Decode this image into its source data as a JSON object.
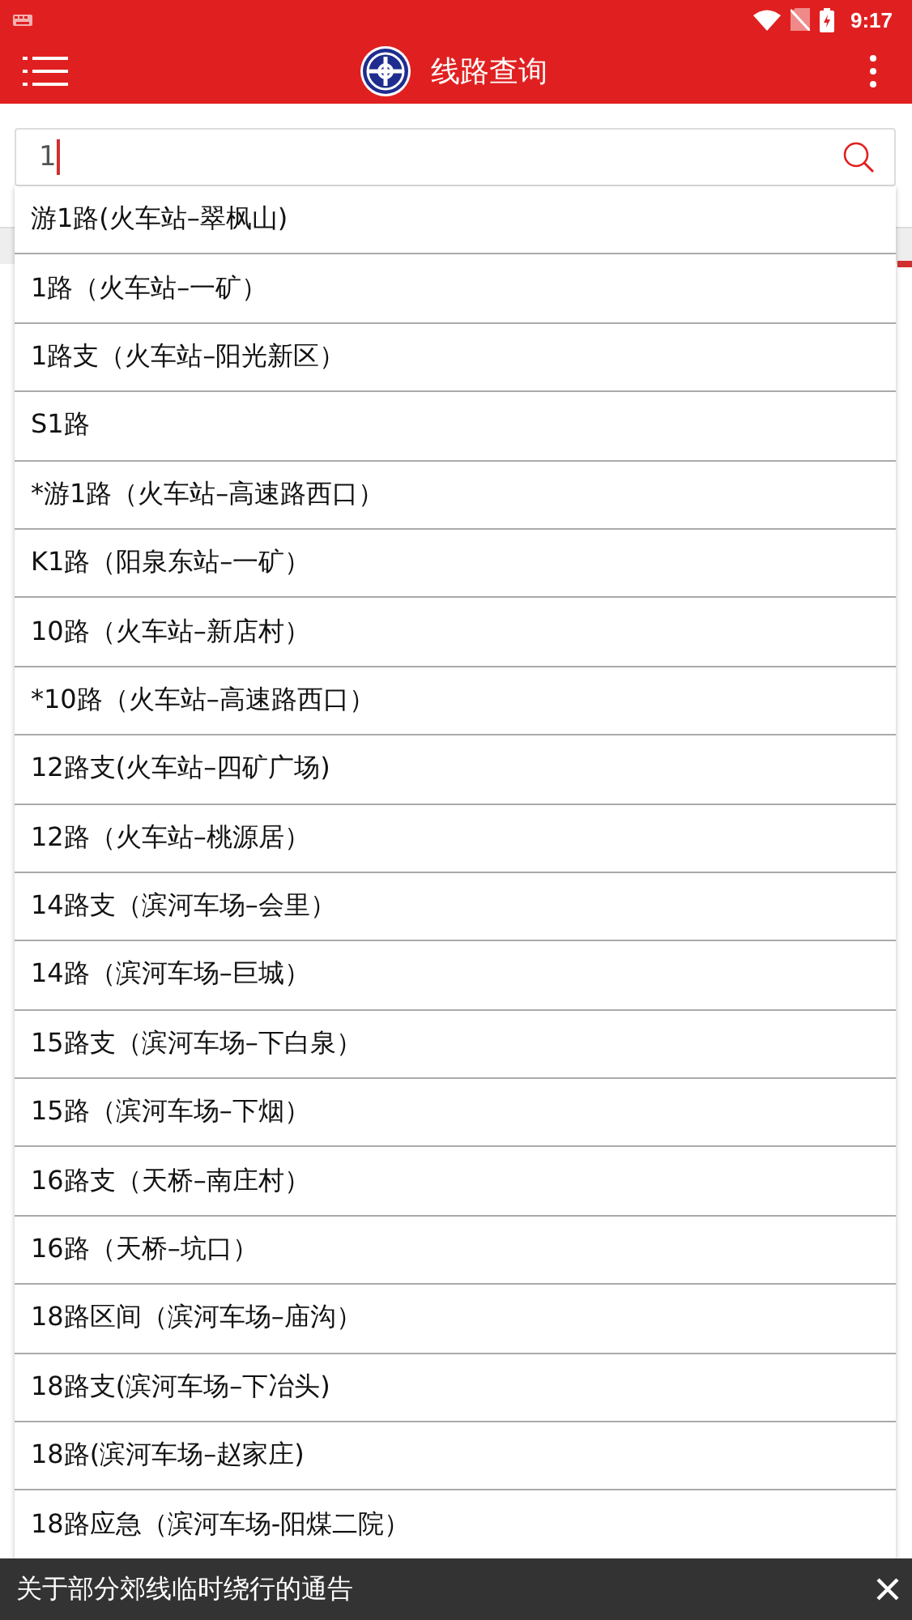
{
  "status_bar": {
    "time": "9:17"
  },
  "toolbar": {
    "title": "线路查询"
  },
  "search": {
    "value": "1"
  },
  "suggestions": [
    {
      "label": "游1路(火车站–翠枫山)"
    },
    {
      "label": "1路（火车站–一矿）"
    },
    {
      "label": "1路支（火车站–阳光新区）"
    },
    {
      "label": "S1路"
    },
    {
      "label": "*游1路（火车站–高速路西口）"
    },
    {
      "label": "K1路（阳泉东站–一矿）"
    },
    {
      "label": "10路（火车站–新店村）"
    },
    {
      "label": "*10路（火车站–高速路西口）"
    },
    {
      "label": "12路支(火车站–四矿广场)"
    },
    {
      "label": "12路（火车站–桃源居）"
    },
    {
      "label": "14路支（滨河车场–会里）"
    },
    {
      "label": "14路（滨河车场–巨城）"
    },
    {
      "label": "15路支（滨河车场–下白泉）"
    },
    {
      "label": "15路（滨河车场–下烟）"
    },
    {
      "label": "16路支（天桥–南庄村）"
    },
    {
      "label": "16路（天桥–坑口）"
    },
    {
      "label": "18路区间（滨河车场–庙沟）"
    },
    {
      "label": "18路支(滨河车场–下冶头)"
    },
    {
      "label": "18路(滨河车场–赵家庄)"
    },
    {
      "label": "18路应急（滨河车场-阳煤二院）"
    }
  ],
  "notice": {
    "text": "关于部分郊线临时绕行的通告"
  }
}
